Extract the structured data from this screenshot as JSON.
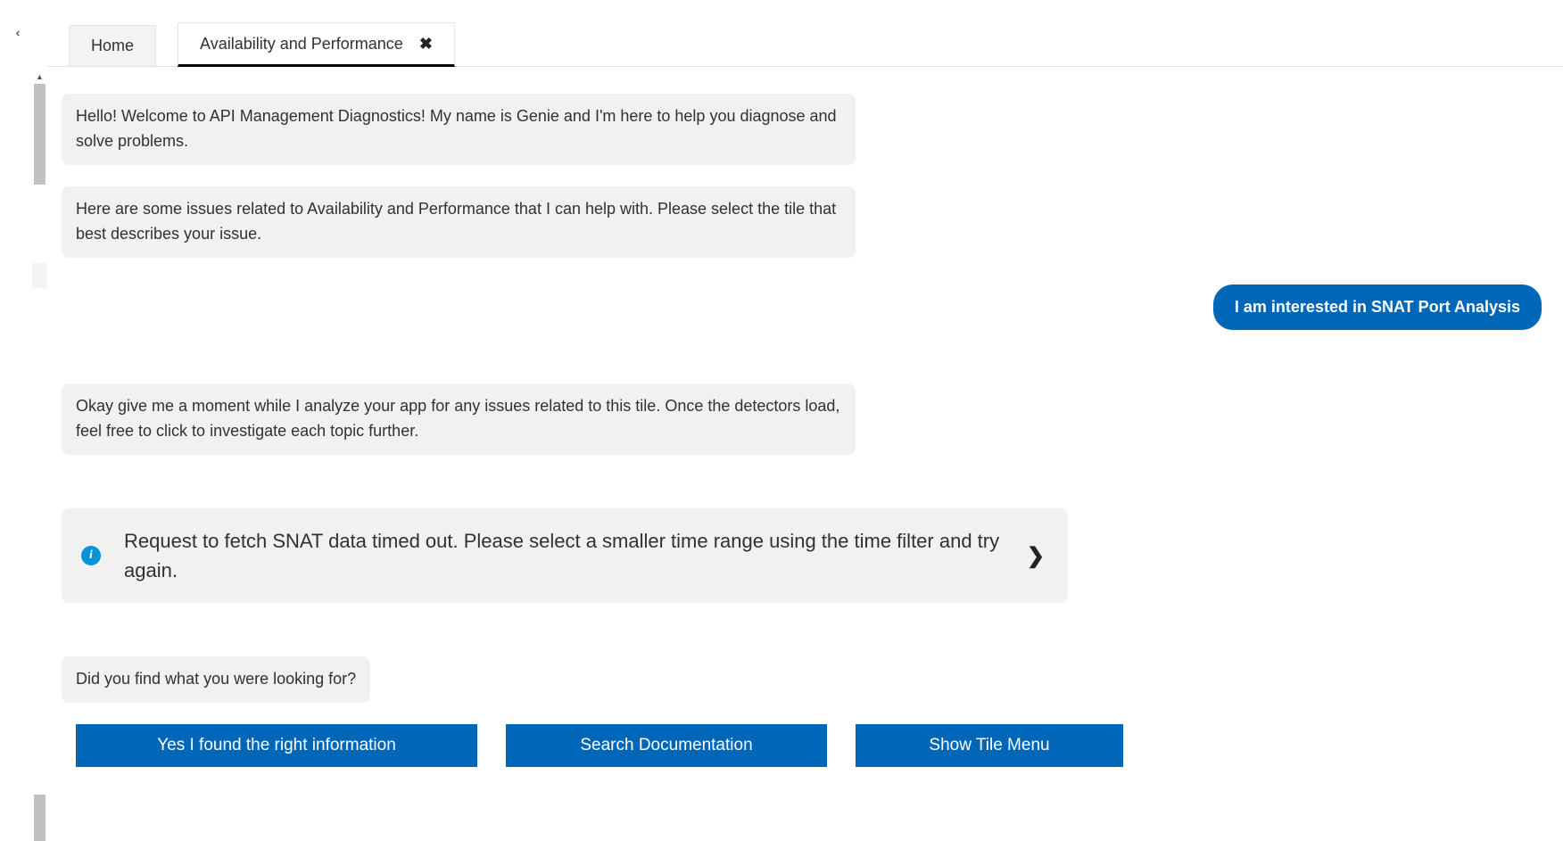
{
  "tabs": {
    "home": "Home",
    "active": "Availability and Performance"
  },
  "messages": {
    "bot_greeting": "Hello! Welcome to API Management Diagnostics! My name is Genie and I'm here to help you diagnose and solve problems.",
    "bot_issues": "Here are some issues related to Availability and Performance that I can help with. Please select the tile that best describes your issue.",
    "user_request": "I am interested in SNAT Port Analysis",
    "bot_analyzing": "Okay give me a moment while I analyze your app for any issues related to this tile. Once the detectors load, feel free to click to investigate each topic further.",
    "info_card": "Request to fetch SNAT data timed out. Please select a smaller time range using the time filter and try again.",
    "bot_followup": "Did you find what you were looking for?"
  },
  "actions": {
    "yes": "Yes I found the right information",
    "search": "Search Documentation",
    "tile_menu": "Show Tile Menu"
  }
}
